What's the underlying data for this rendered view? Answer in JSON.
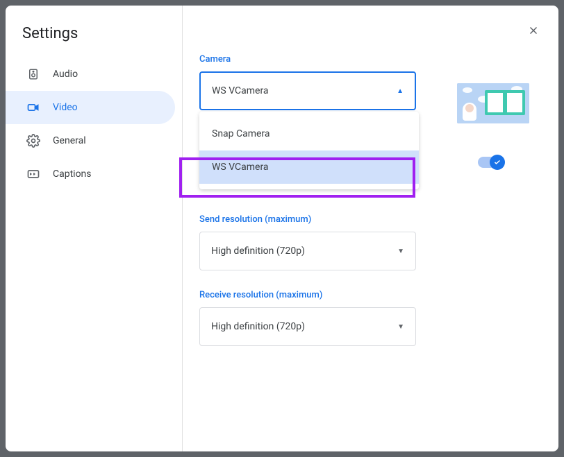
{
  "title": "Settings",
  "sidebar": {
    "items": [
      {
        "label": "Audio"
      },
      {
        "label": "Video"
      },
      {
        "label": "General"
      },
      {
        "label": "Captions"
      }
    ]
  },
  "video": {
    "camera_label": "Camera",
    "camera_selected": "WS VCamera",
    "camera_options": [
      "Snap Camera",
      "WS VCamera"
    ],
    "hd_toggle_on": true,
    "send_label": "Send resolution (maximum)",
    "send_selected": "High definition (720p)",
    "receive_label": "Receive resolution (maximum)",
    "receive_selected": "High definition (720p)"
  }
}
